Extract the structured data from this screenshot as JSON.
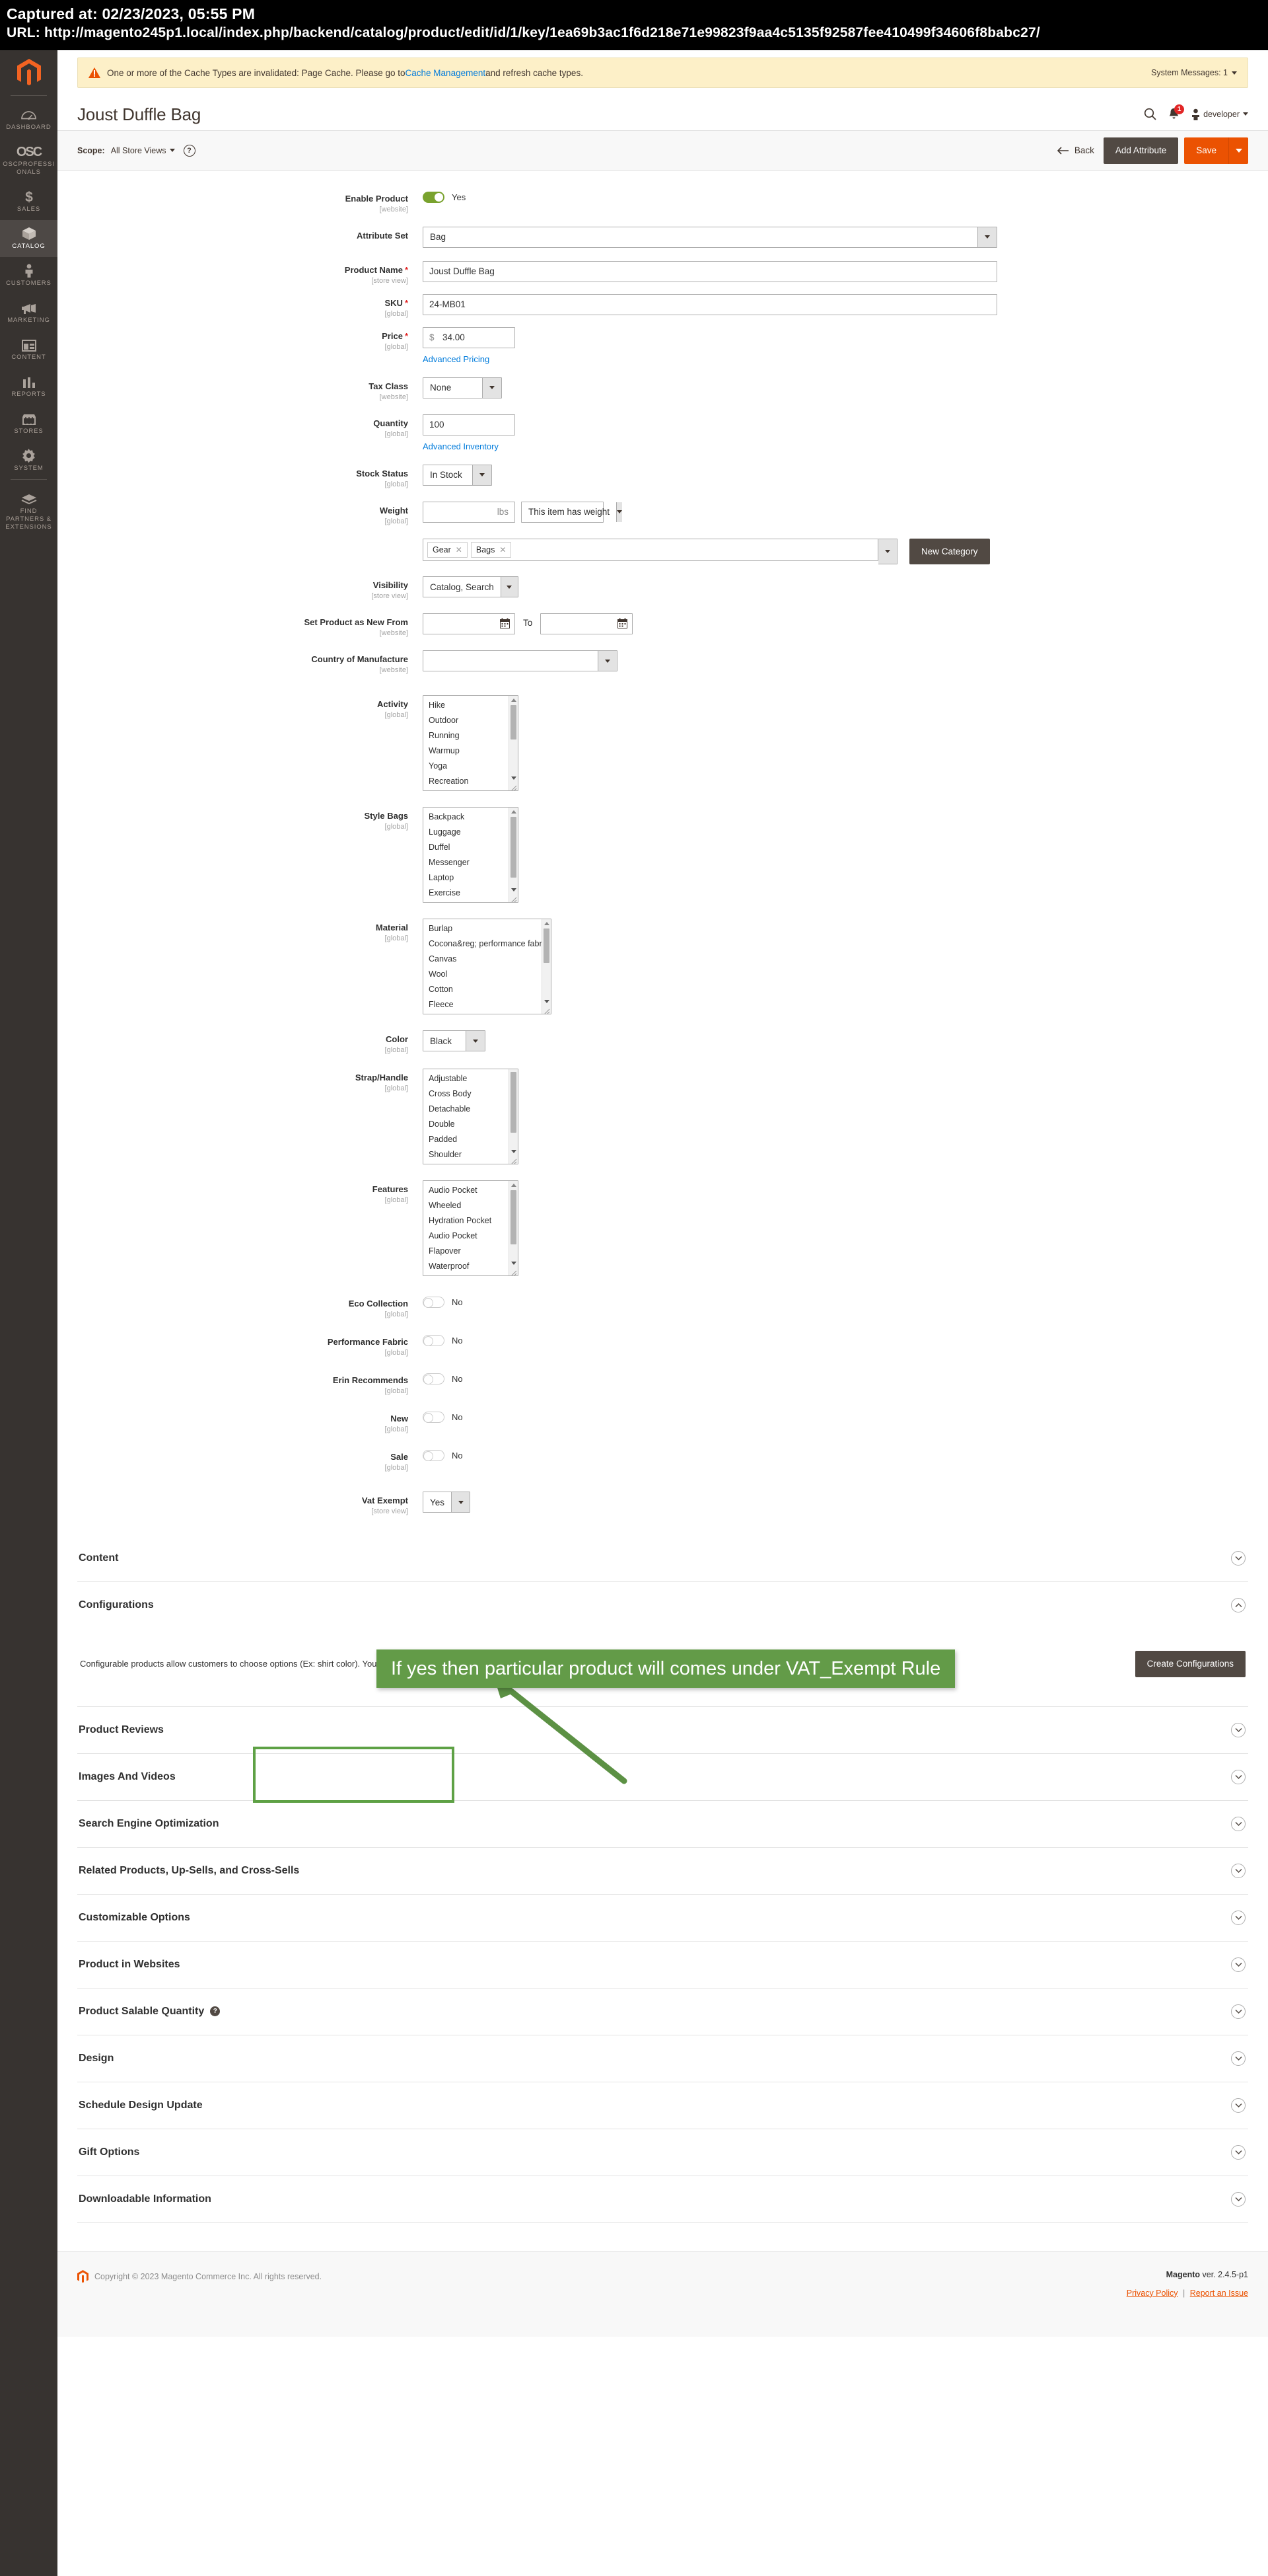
{
  "capture": {
    "timestamp_line": "Captured at: 02/23/2023, 05:55 PM",
    "url_line": "URL: http://magento245p1.local/index.php/backend/catalog/product/edit/id/1/key/1ea69b3ac1f6d218e71e99823f9aa4c5135f92587fee410499f34606f8babc27/"
  },
  "sidebar": {
    "items": [
      {
        "label": "DASHBOARD",
        "icon": "dashboard-icon",
        "active": false
      },
      {
        "label": "OSCPROFESSIONALS",
        "icon": "osc-logo-icon",
        "active": false
      },
      {
        "label": "SALES",
        "icon": "dollar-icon",
        "active": false
      },
      {
        "label": "CATALOG",
        "icon": "box-icon",
        "active": true
      },
      {
        "label": "CUSTOMERS",
        "icon": "person-icon",
        "active": false
      },
      {
        "label": "MARKETING",
        "icon": "megaphone-icon",
        "active": false
      },
      {
        "label": "CONTENT",
        "icon": "layout-icon",
        "active": false
      },
      {
        "label": "REPORTS",
        "icon": "bar-chart-icon",
        "active": false
      },
      {
        "label": "STORES",
        "icon": "storefront-icon",
        "active": false
      },
      {
        "label": "SYSTEM",
        "icon": "gear-icon",
        "active": false
      },
      {
        "label": "FIND PARTNERS & EXTENSIONS",
        "icon": "extension-icon",
        "active": false
      }
    ]
  },
  "system_message": {
    "text_before_link": "One or more of the Cache Types are invalidated: Page Cache. Please go to ",
    "link_text": "Cache Management",
    "text_after_link": " and refresh cache types.",
    "counter_label": "System Messages: 1"
  },
  "header": {
    "page_title": "Joust Duffle Bag",
    "search_icon": "search-icon",
    "notification_icon": "bell-icon",
    "notification_count": "1",
    "user_name": "developer"
  },
  "toolbar": {
    "scope_label": "Scope:",
    "scope_value": "All Store Views",
    "help_label": "?",
    "back_label": "Back",
    "add_attribute_label": "Add Attribute",
    "save_label": "Save"
  },
  "form": {
    "enable_product": {
      "label": "Enable Product",
      "scope": "[website]",
      "value": "Yes",
      "on": true
    },
    "attribute_set": {
      "label": "Attribute Set",
      "scope": "",
      "value": "Bag"
    },
    "product_name": {
      "label": "Product Name",
      "scope": "[store view]",
      "value": "Joust Duffle Bag",
      "required": true
    },
    "sku": {
      "label": "SKU",
      "scope": "[global]",
      "value": "24-MB01",
      "required": true
    },
    "price": {
      "label": "Price",
      "scope": "[global]",
      "currency": "$",
      "value": "34.00",
      "required": true,
      "link": "Advanced Pricing"
    },
    "tax_class": {
      "label": "Tax Class",
      "scope": "[website]",
      "value": "None"
    },
    "quantity": {
      "label": "Quantity",
      "scope": "[global]",
      "value": "100",
      "link": "Advanced Inventory"
    },
    "stock_status": {
      "label": "Stock Status",
      "scope": "[global]",
      "value": "In Stock"
    },
    "weight": {
      "label": "Weight",
      "scope": "[global]",
      "value": "",
      "unit": "lbs",
      "select_value": "This item has weight"
    },
    "categories": {
      "label": "",
      "scope": "",
      "chips": [
        "Gear",
        "Bags"
      ],
      "new_category_label": "New Category"
    },
    "visibility": {
      "label": "Visibility",
      "scope": "[store view]",
      "value": "Catalog, Search"
    },
    "set_new_from": {
      "label": "Set Product as New From",
      "scope": "[website]",
      "from_value": "",
      "to_word": "To",
      "to_value": ""
    },
    "country_of_manufacture": {
      "label": "Country of Manufacture",
      "scope": "[website]",
      "value": ""
    },
    "activity": {
      "label": "Activity",
      "scope": "[global]",
      "options": [
        "Hike",
        "Outdoor",
        "Running",
        "Warmup",
        "Yoga",
        "Recreation"
      ]
    },
    "style_bags": {
      "label": "Style Bags",
      "scope": "[global]",
      "options": [
        "Backpack",
        "Luggage",
        "Duffel",
        "Messenger",
        "Laptop",
        "Exercise"
      ]
    },
    "material": {
      "label": "Material",
      "scope": "[global]",
      "options": [
        "Burlap",
        "Cocona&reg; performance fabric",
        "Canvas",
        "Wool",
        "Cotton",
        "Fleece"
      ]
    },
    "color": {
      "label": "Color",
      "scope": "[global]",
      "value": "Black"
    },
    "strap_handle": {
      "label": "Strap/Handle",
      "scope": "[global]",
      "options": [
        "Adjustable",
        "Cross Body",
        "Detachable",
        "Double",
        "Padded",
        "Shoulder"
      ]
    },
    "features": {
      "label": "Features",
      "scope": "[global]",
      "options": [
        "Audio Pocket",
        "Wheeled",
        "Hydration Pocket",
        "Audio Pocket",
        "Flapover",
        "Waterproof"
      ]
    },
    "eco_collection": {
      "label": "Eco Collection",
      "scope": "[global]",
      "value": "No",
      "on": false
    },
    "performance_fabric": {
      "label": "Performance Fabric",
      "scope": "[global]",
      "value": "No",
      "on": false
    },
    "erin_recommends": {
      "label": "Erin Recommends",
      "scope": "[global]",
      "value": "No",
      "on": false
    },
    "new": {
      "label": "New",
      "scope": "[global]",
      "value": "No",
      "on": false
    },
    "sale": {
      "label": "Sale",
      "scope": "[global]",
      "value": "No",
      "on": false
    },
    "vat_exempt": {
      "label": "Vat Exempt",
      "scope": "[store view]",
      "value": "Yes"
    }
  },
  "annotation": {
    "text": "If yes then particular product will comes under VAT_Exempt Rule",
    "color": "#639b48"
  },
  "sections": {
    "content": {
      "title": "Content",
      "state": "collapsed"
    },
    "configurations": {
      "title": "Configurations",
      "state": "expanded",
      "description": "Configurable products allow customers to choose options (Ex: shirt color). You need to create a simple product for each configuration (Ex: a product for each color).",
      "button_label": "Create Configurations"
    },
    "rest": [
      {
        "title": "Product Reviews",
        "help": false
      },
      {
        "title": "Images And Videos",
        "help": false
      },
      {
        "title": "Search Engine Optimization",
        "help": false
      },
      {
        "title": "Related Products, Up-Sells, and Cross-Sells",
        "help": false
      },
      {
        "title": "Customizable Options",
        "help": false
      },
      {
        "title": "Product in Websites",
        "help": false
      },
      {
        "title": "Product Salable Quantity",
        "help": true
      },
      {
        "title": "Design",
        "help": false
      },
      {
        "title": "Schedule Design Update",
        "help": false
      },
      {
        "title": "Gift Options",
        "help": false
      },
      {
        "title": "Downloadable Information",
        "help": false
      }
    ]
  },
  "footer": {
    "copyright": "Copyright © 2023 Magento Commerce Inc. All rights reserved.",
    "version_brand": "Magento",
    "version_text": " ver. 2.4.5-p1",
    "privacy_label": "Privacy Policy",
    "separator": "|",
    "report_label": "Report an Issue"
  }
}
